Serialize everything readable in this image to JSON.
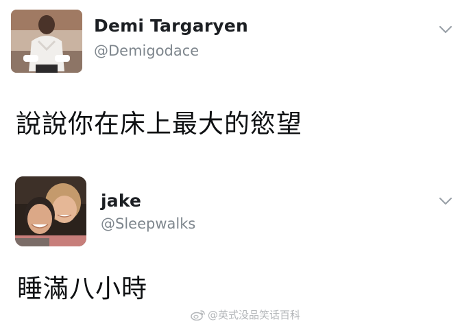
{
  "tweets": [
    {
      "author_name": "Demi Targaryen",
      "author_handle": "@Demigodace",
      "text": "說說你在床上最大的慾望",
      "avatar_icon": "user-photo-avatar",
      "menu_icon": "chevron-down-icon"
    },
    {
      "author_name": "jake",
      "author_handle": "@Sleepwalks",
      "text": "睡滿八小時",
      "avatar_icon": "couple-photo-avatar",
      "menu_icon": "chevron-down-icon"
    }
  ],
  "watermark": {
    "text": "@英式没品笑话百科",
    "icon": "weibo-icon"
  },
  "colors": {
    "name": "#1c1f23",
    "handle": "#7e868d",
    "chevron": "#9aa1a8",
    "watermark": "#b3b6b9"
  }
}
